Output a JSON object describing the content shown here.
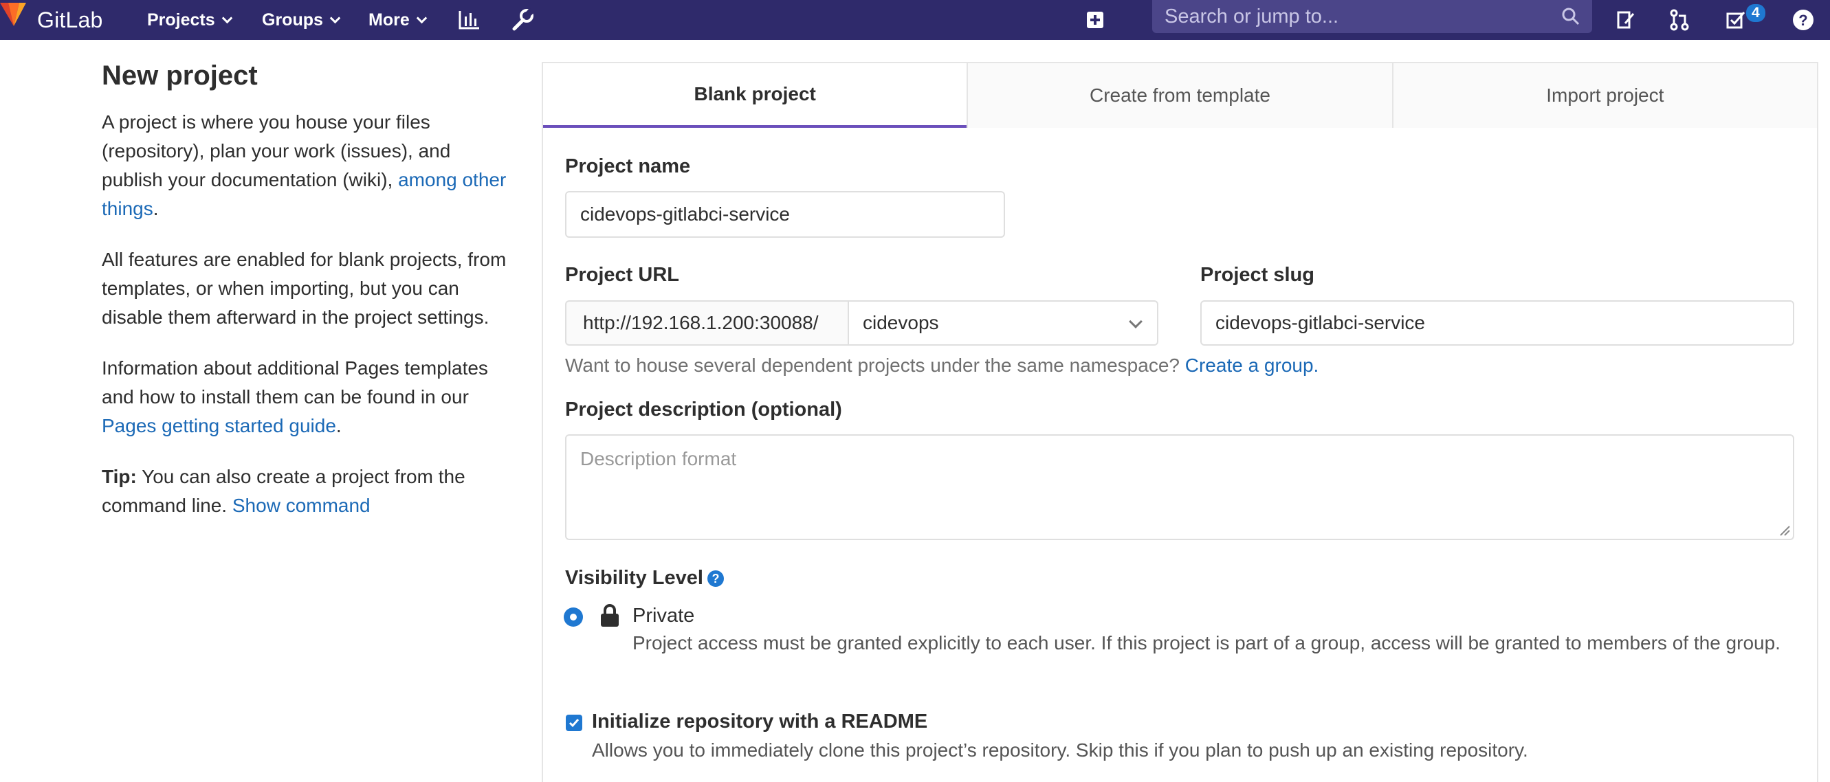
{
  "navbar": {
    "brand": "GitLab",
    "menu": [
      "Projects",
      "Groups",
      "More"
    ],
    "search_placeholder": "Search or jump to...",
    "todos_count": "4",
    "colors": {
      "bg": "#2f2a6b",
      "search_bg": "#4b4589",
      "badge": "#1f78d1"
    }
  },
  "sidebar": {
    "title": "New project",
    "p1_text": "A project is where you house your files (repository), plan your work (issues), and publish your documentation (wiki), ",
    "p1_link": "among other things",
    "p1_end": ".",
    "p2": "All features are enabled for blank projects, from templates, or when importing, but you can disable them afterward in the project settings.",
    "p3_text": "Information about additional Pages templates and how to install them can be found in our ",
    "p3_link": "Pages getting started guide",
    "p3_end": ".",
    "tip_label": "Tip:",
    "tip_text": " You can also create a project from the command line. ",
    "tip_link": "Show command"
  },
  "tabs": [
    "Blank project",
    "Create from template",
    "Import project"
  ],
  "form": {
    "project_name_label": "Project name",
    "project_name_value": "cidevops-gitlabci-service",
    "project_url_label": "Project URL",
    "project_url_prefix": "http://192.168.1.200:30088/",
    "namespace_value": "cidevops",
    "project_slug_label": "Project slug",
    "project_slug_value": "cidevops-gitlabci-service",
    "namespace_help": "Want to house several dependent projects under the same namespace? ",
    "namespace_help_link": "Create a group.",
    "description_label": "Project description (optional)",
    "description_placeholder": "Description format",
    "visibility_label": "Visibility Level",
    "visibility_option": "Private",
    "visibility_desc": "Project access must be granted explicitly to each user. If this project is part of a group, access will be granted to members of the group.",
    "readme_label": "Initialize repository with a README",
    "readme_desc": "Allows you to immediately clone this project’s repository. Skip this if you plan to push up an existing repository."
  }
}
